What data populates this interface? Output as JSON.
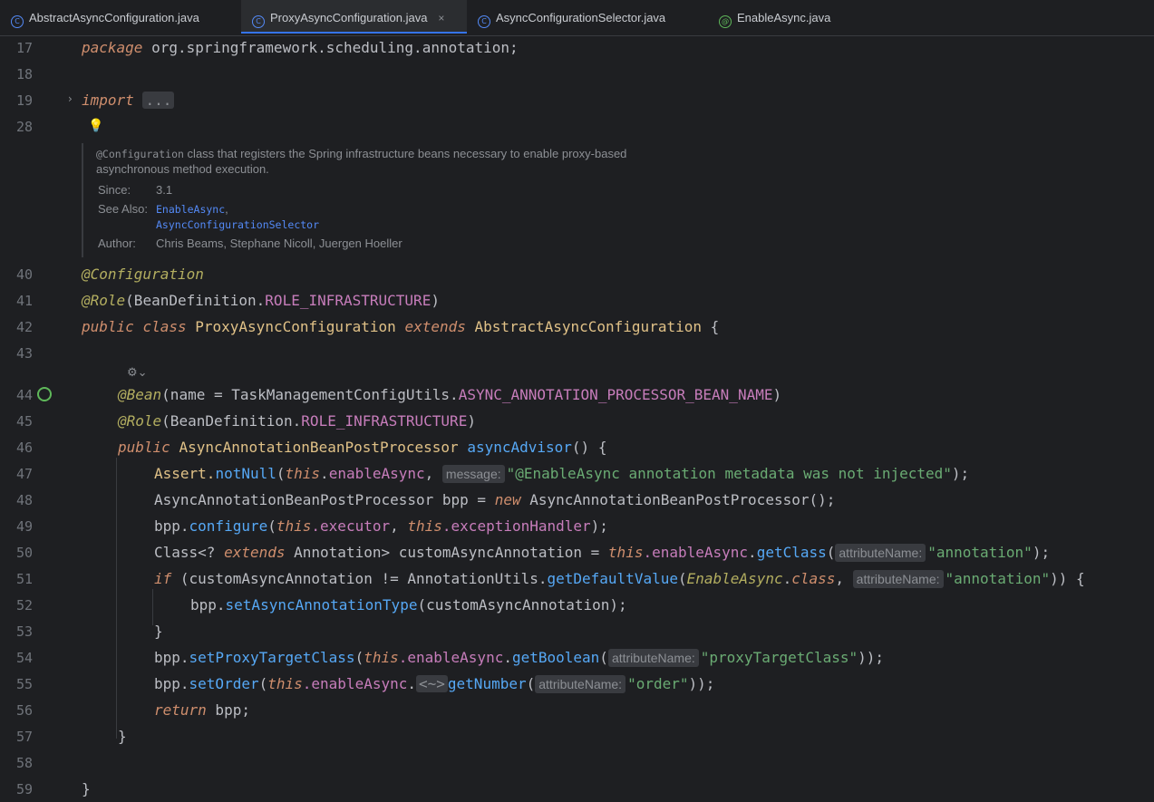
{
  "tabs": [
    {
      "label": "AbstractAsyncConfiguration.java",
      "icon": "class-icon"
    },
    {
      "label": "ProxyAsyncConfiguration.java",
      "icon": "class-icon",
      "close": "×"
    },
    {
      "label": "AsyncConfigurationSelector.java",
      "icon": "class-icon"
    },
    {
      "label": "EnableAsync.java",
      "icon": "annotation-icon"
    }
  ],
  "line_numbers": [
    "17",
    "18",
    "19",
    "28",
    "40",
    "41",
    "42",
    "43",
    "44",
    "45",
    "46",
    "47",
    "48",
    "49",
    "50",
    "51",
    "52",
    "53",
    "54",
    "55",
    "56",
    "57",
    "58",
    "59"
  ],
  "code": {
    "l17_kw": "package",
    "l17_rest": " org.springframework.scheduling.annotation;",
    "l19_kw": "import",
    "l19_fold": "...",
    "l40": "@Configuration",
    "l41_anno": "@Role",
    "l41_a": "(BeanDefinition.",
    "l41_c": "ROLE_INFRASTRUCTURE",
    "l41_b": ")",
    "l42_kw1": "public",
    "l42_kw2": "class",
    "l42_name": "ProxyAsyncConfiguration",
    "l42_kw3": "extends",
    "l42_super": "AbstractAsyncConfiguration",
    "l42_brace": "{",
    "l44_anno": "@Bean",
    "l44_a": "(name = TaskManagementConfigUtils.",
    "l44_c": "ASYNC_ANNOTATION_PROCESSOR_BEAN_NAME",
    "l44_b": ")",
    "l45_anno": "@Role",
    "l45_a": "(BeanDefinition.",
    "l45_c": "ROLE_INFRASTRUCTURE",
    "l45_b": ")",
    "l46_kw": "public",
    "l46_type": "AsyncAnnotationBeanPostProcessor",
    "l46_method": "asyncAdvisor",
    "l46_end": "() {",
    "l47_a": "Assert.",
    "l47_m": "notNull",
    "l47_b": "(",
    "l47_this": "this",
    "l47_dot": ".",
    "l47_f": "enableAsync",
    "l47_c": ", ",
    "l47_hint": "message:",
    "l47_str": "\"@EnableAsync annotation metadata was not injected\"",
    "l47_end": ");",
    "l48_a": "AsyncAnnotationBeanPostProcessor bpp = ",
    "l48_kw": "new",
    "l48_b": " AsyncAnnotationBeanPostProcessor();",
    "l49_a": "bpp.",
    "l49_m": "configure",
    "l49_b": "(",
    "l49_this1": "this",
    "l49_f1": ".executor",
    "l49_c": ", ",
    "l49_this2": "this",
    "l49_f2": ".exceptionHandler",
    "l49_end": ");",
    "l50_a": "Class<? ",
    "l50_kw": "extends",
    "l50_b": " Annotation> customAsyncAnnotation = ",
    "l50_this": "this",
    "l50_f": ".enableAsync",
    "l50_dot": ".",
    "l50_m": "getClass",
    "l50_p": "(",
    "l50_hint": "attributeName:",
    "l50_str": "\"annotation\"",
    "l50_end": ");",
    "l51_kw": "if",
    "l51_a": " (customAsyncAnnotation != AnnotationUtils.",
    "l51_m": "getDefaultValue",
    "l51_b": "(",
    "l51_cls": "EnableAsync",
    "l51_dot": ".",
    "l51_kw2": "class",
    "l51_c": ", ",
    "l51_hint": "attributeName:",
    "l51_str": "\"annotation\"",
    "l51_end": ")) {",
    "l52_a": "bpp.",
    "l52_m": "setAsyncAnnotationType",
    "l52_b": "(customAsyncAnnotation);",
    "l53": "}",
    "l54_a": "bpp.",
    "l54_m": "setProxyTargetClass",
    "l54_b": "(",
    "l54_this": "this",
    "l54_f": ".enableAsync",
    "l54_dot": ".",
    "l54_m2": "getBoolean",
    "l54_p": "(",
    "l54_hint": "attributeName:",
    "l54_str": "\"proxyTargetClass\"",
    "l54_end": "));",
    "l55_a": "bpp.",
    "l55_m": "setOrder",
    "l55_b": "(",
    "l55_this": "this",
    "l55_f": ".enableAsync",
    "l55_dot": ".",
    "l55_fold": "<~>",
    "l55_m2": "getNumber",
    "l55_p": "(",
    "l55_hint": "attributeName:",
    "l55_str": "\"order\"",
    "l55_end": "));",
    "l56_kw": "return",
    "l56_b": " bpp;",
    "l57": "}",
    "l59": "}"
  },
  "javadoc": {
    "code_tag": "@Configuration",
    "text1": " class that registers the Spring infrastructure beans necessary to enable proxy-based",
    "text2": "asynchronous method execution.",
    "since_label": "Since:",
    "since_value": "3.1",
    "see_label": "See Also:",
    "see_link1": "EnableAsync",
    "see_sep": ",",
    "see_link2": "AsyncConfigurationSelector",
    "author_label": "Author:",
    "author_value": "Chris Beams, Stephane Nicoll, Juergen Hoeller"
  }
}
